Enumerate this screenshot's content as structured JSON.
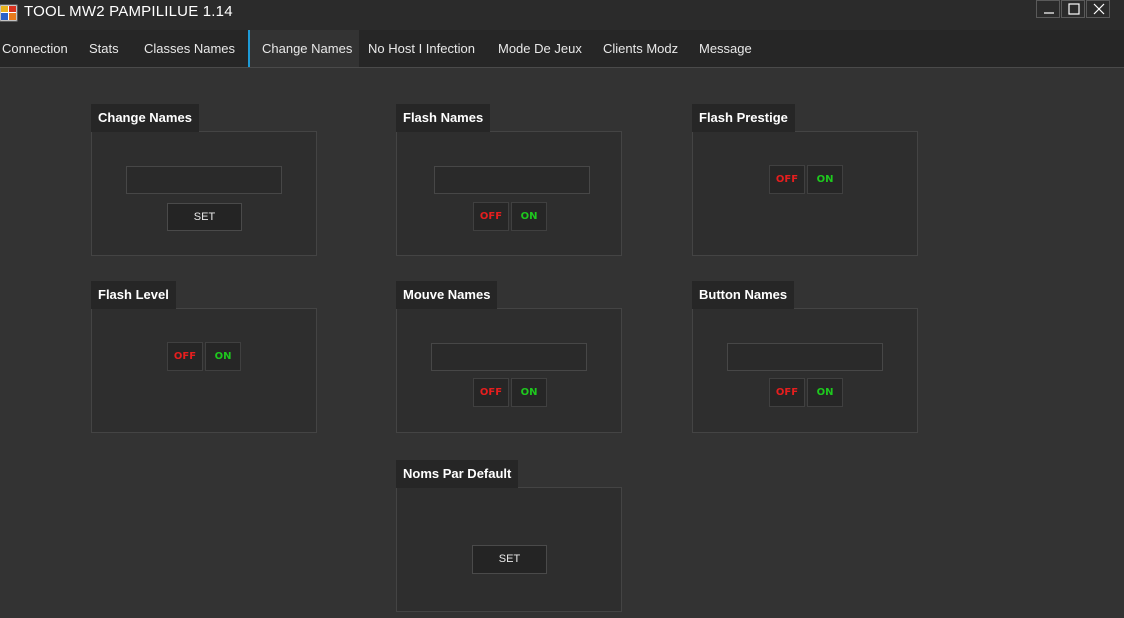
{
  "window": {
    "title": "TOOL MW2 PAMPILILUE 1.14",
    "minimize_icon": "minimize-icon",
    "maximize_icon": "maximize-icon",
    "close_icon": "close-icon"
  },
  "tabs": [
    {
      "label": "Connection"
    },
    {
      "label": "Stats"
    },
    {
      "label": "Classes Names"
    },
    {
      "label": "Change Names",
      "active": true
    },
    {
      "label": "No Host I Infection"
    },
    {
      "label": "Mode De Jeux"
    },
    {
      "label": "Clients Modz"
    },
    {
      "label": "Message"
    }
  ],
  "colors": {
    "accent": "#1e9bd7",
    "off": "#e61e1e",
    "on": "#1ec81e"
  },
  "groups": {
    "change_names": {
      "title": "Change Names",
      "input_value": "",
      "set_label": "SET"
    },
    "flash_names": {
      "title": "Flash Names",
      "input_value": "",
      "off_label": "OFF",
      "on_label": "ON"
    },
    "flash_prestige": {
      "title": "Flash Prestige",
      "off_label": "OFF",
      "on_label": "ON"
    },
    "flash_level": {
      "title": "Flash Level",
      "off_label": "OFF",
      "on_label": "ON"
    },
    "mouve_names": {
      "title": "Mouve Names",
      "input_value": "",
      "off_label": "OFF",
      "on_label": "ON"
    },
    "button_names": {
      "title": "Button Names",
      "input_value": "",
      "off_label": "OFF",
      "on_label": "ON"
    },
    "noms_par_default": {
      "title": "Noms Par Default",
      "set_label": "SET"
    }
  }
}
